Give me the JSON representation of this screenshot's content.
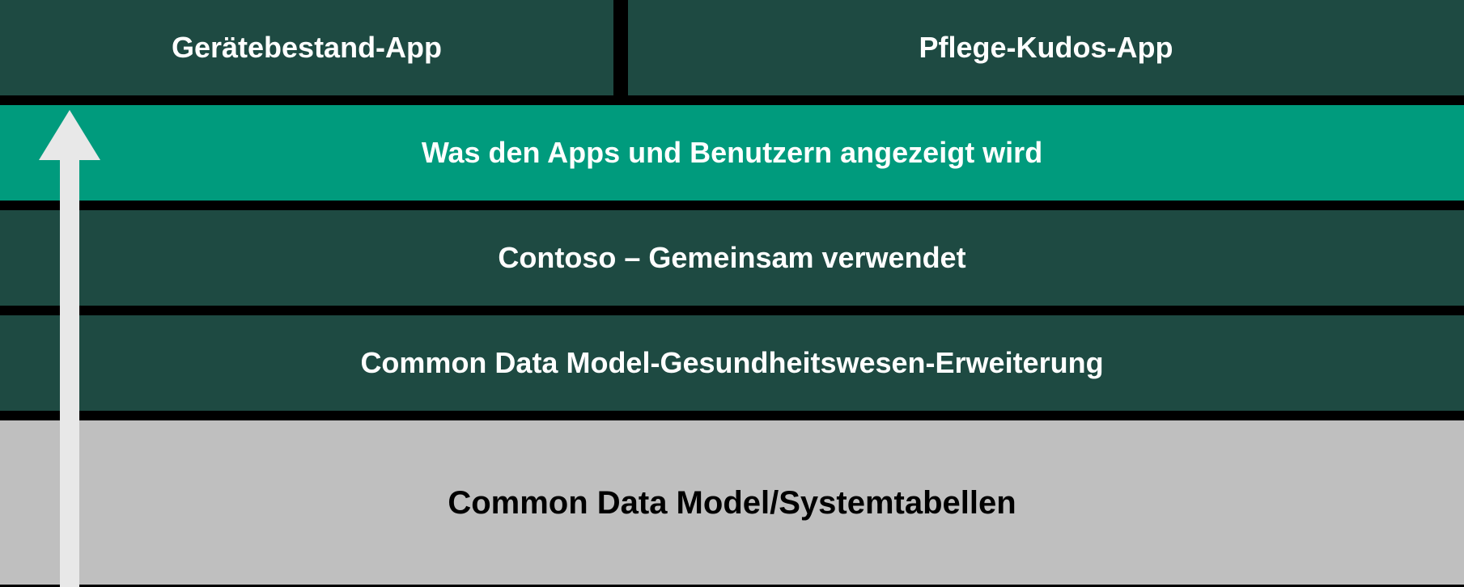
{
  "diagram": {
    "top_apps": {
      "left": "Gerätebestand-App",
      "right": "Pflege-Kudos-App"
    },
    "layers": [
      "Was den Apps und Benutzern angezeigt wird",
      "Contoso – Gemeinsam verwendet",
      "Common Data Model-Gesundheitswesen-Erweiterung",
      "Common Data Model/Systemtabellen"
    ],
    "colors": {
      "dark_teal": "#1e4a42",
      "bright_teal": "#009b7d",
      "gray": "#bfbfbf",
      "arrow": "#e8e8e8"
    }
  }
}
